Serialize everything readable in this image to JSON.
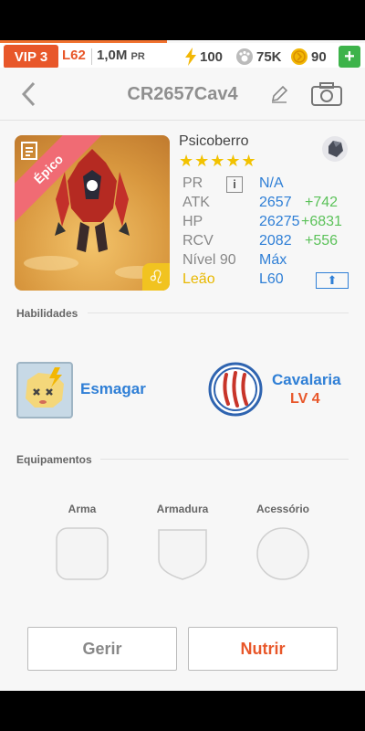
{
  "status": {
    "vip": "VIP 3",
    "level": "L62",
    "power": "1,0M",
    "power_unit": "PR",
    "energy": "100",
    "paw": "75K",
    "coins": "90",
    "plus_icon": "plus-icon"
  },
  "header": {
    "title": "CR2657Cav4"
  },
  "monster": {
    "rarity": "Épico",
    "name": "Psicoberro",
    "stars": "★★★★★",
    "zodiac_symbol": "♌",
    "stats": [
      {
        "key": "PR",
        "value": "N/A",
        "bonus": ""
      },
      {
        "key": "ATK",
        "value": "2657",
        "bonus": "+742"
      },
      {
        "key": "HP",
        "value": "26275",
        "bonus": "+6831"
      },
      {
        "key": "RCV",
        "value": "2082",
        "bonus": "+556"
      },
      {
        "key": "Nível 90",
        "value": "Máx",
        "bonus": ""
      },
      {
        "key": "Leão",
        "value": "L60",
        "bonus": ""
      }
    ]
  },
  "skills": {
    "title": "Habilidades",
    "skill_name": "Esmagar",
    "class_name": "Cavalaria",
    "class_level": "LV 4"
  },
  "equipment": {
    "title": "Equipamentos",
    "slots": [
      "Arma",
      "Armadura",
      "Acessório"
    ]
  },
  "actions": {
    "manage": "Gerir",
    "feed": "Nutrir"
  },
  "colors": {
    "accent_blue": "#2f7fd6",
    "accent_orange": "#e8572a",
    "bonus_green": "#5cc25a",
    "star_yellow": "#f2c200",
    "epic_pink": "#f06b74"
  }
}
